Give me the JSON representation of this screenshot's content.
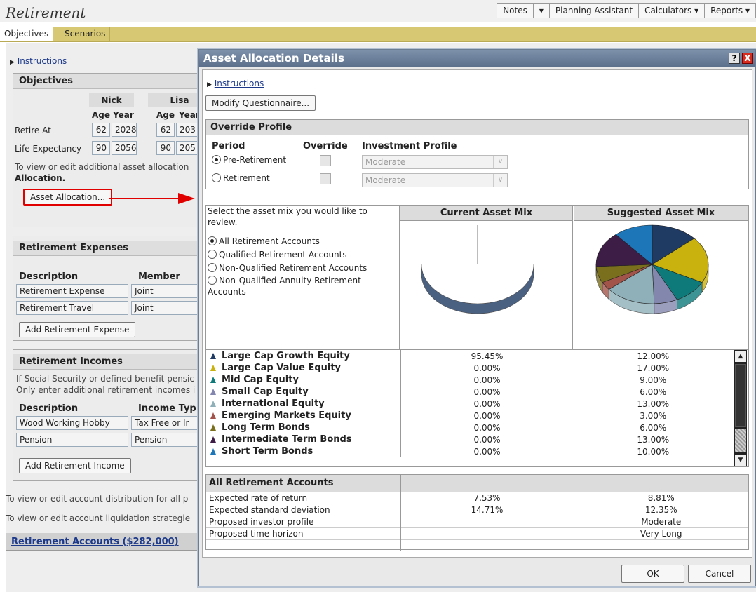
{
  "app": {
    "title": "Retirement"
  },
  "top_menu": [
    {
      "label": "Notes"
    },
    {
      "label": "▾"
    },
    {
      "label": "Planning Assistant"
    },
    {
      "label": "Calculators ▾"
    },
    {
      "label": "Reports ▾"
    }
  ],
  "tabs": [
    {
      "label": "Objectives"
    },
    {
      "label": "Scenarios"
    }
  ],
  "background": {
    "instructions_link": "Instructions",
    "objectives": {
      "header": "Objectives",
      "members": [
        "Nick",
        "Lisa"
      ],
      "col_age": "Age",
      "col_year": "Year",
      "rows": [
        {
          "label": "Retire At",
          "nick_age": "62",
          "nick_year": "2028",
          "lisa_age": "62",
          "lisa_year": "203"
        },
        {
          "label": "Life Expectancy",
          "nick_age": "90",
          "nick_year": "2056",
          "lisa_age": "90",
          "lisa_year": "205"
        }
      ],
      "note_line1": "To view or edit additional asset allocation",
      "note_line2": "Allocation.",
      "asset_allocation_button": "Asset Allocation..."
    },
    "expenses": {
      "header": "Retirement Expenses",
      "col_description": "Description",
      "col_member": "Member",
      "rows": [
        {
          "description": "Retirement Expense",
          "member": "Joint"
        },
        {
          "description": "Retirement Travel",
          "member": "Joint"
        }
      ],
      "add_button": "Add Retirement Expense"
    },
    "incomes": {
      "header": "Retirement Incomes",
      "note_line1": "If Social Security or defined benefit pensic",
      "note_line2": "Only enter additional retirement incomes i",
      "col_description": "Description",
      "col_type": "Income Typ",
      "rows": [
        {
          "description": "Wood Working Hobby",
          "type": "Tax Free or Ir"
        },
        {
          "description": "Pension",
          "type": "Pension"
        }
      ],
      "add_button": "Add Retirement Income"
    },
    "distribution_note": "To view or edit account distribution for all p",
    "liquidation_note": "To view or edit account liquidation strategie",
    "accounts_link": "Retirement Accounts ($282,000)"
  },
  "dialog": {
    "title": "Asset Allocation Details",
    "help_label": "?",
    "close_label": "X",
    "instructions_link": "Instructions",
    "modify_button": "Modify Questionnaire...",
    "override_profile": {
      "header": "Override Profile",
      "col_period": "Period",
      "col_override": "Override",
      "col_investment_profile": "Investment Profile",
      "rows": [
        {
          "period": "Pre-Retirement",
          "selected": true,
          "profile": "Moderate"
        },
        {
          "period": "Retirement",
          "selected": false,
          "profile": "Moderate"
        }
      ]
    },
    "mix": {
      "prompt": "Select the asset mix you would like to review.",
      "options": [
        {
          "label": "All Retirement Accounts",
          "selected": true
        },
        {
          "label": "Qualified Retirement Accounts",
          "selected": false
        },
        {
          "label": "Non-Qualified Retirement Accounts",
          "selected": false
        },
        {
          "label": "Non-Qualified Annuity Retirement Accounts",
          "selected": false
        }
      ],
      "current_header": "Current Asset Mix",
      "suggested_header": "Suggested Asset Mix"
    },
    "assets": [
      {
        "name": "Large Cap Growth Equity",
        "current": "95.45%",
        "suggested": "12.00%",
        "color": "#1f3a63"
      },
      {
        "name": "Large Cap Value Equity",
        "current": "0.00%",
        "suggested": "17.00%",
        "color": "#c9b20e"
      },
      {
        "name": "Mid Cap Equity",
        "current": "0.00%",
        "suggested": "9.00%",
        "color": "#0f7a7a"
      },
      {
        "name": "Small Cap Equity",
        "current": "0.00%",
        "suggested": "6.00%",
        "color": "#8386ad"
      },
      {
        "name": "International Equity",
        "current": "0.00%",
        "suggested": "13.00%",
        "color": "#8fb0b8"
      },
      {
        "name": "Emerging Markets Equity",
        "current": "0.00%",
        "suggested": "3.00%",
        "color": "#a3544a"
      },
      {
        "name": "Long Term Bonds",
        "current": "0.00%",
        "suggested": "6.00%",
        "color": "#7a6f1d"
      },
      {
        "name": "Intermediate Term Bonds",
        "current": "0.00%",
        "suggested": "13.00%",
        "color": "#3d1c46"
      },
      {
        "name": "Short Term Bonds",
        "current": "0.00%",
        "suggested": "10.00%",
        "color": "#1c76b8"
      }
    ],
    "summary": {
      "header": "All Retirement Accounts",
      "rows": [
        {
          "label": "Expected rate of return",
          "current": "7.53%",
          "suggested": "8.81%"
        },
        {
          "label": "Expected standard deviation",
          "current": "14.71%",
          "suggested": "12.35%"
        },
        {
          "label": "Proposed investor profile",
          "current": "",
          "suggested": "Moderate"
        },
        {
          "label": "Proposed time horizon",
          "current": "",
          "suggested": "Very Long"
        }
      ]
    },
    "ok_button": "OK",
    "cancel_button": "Cancel"
  }
}
